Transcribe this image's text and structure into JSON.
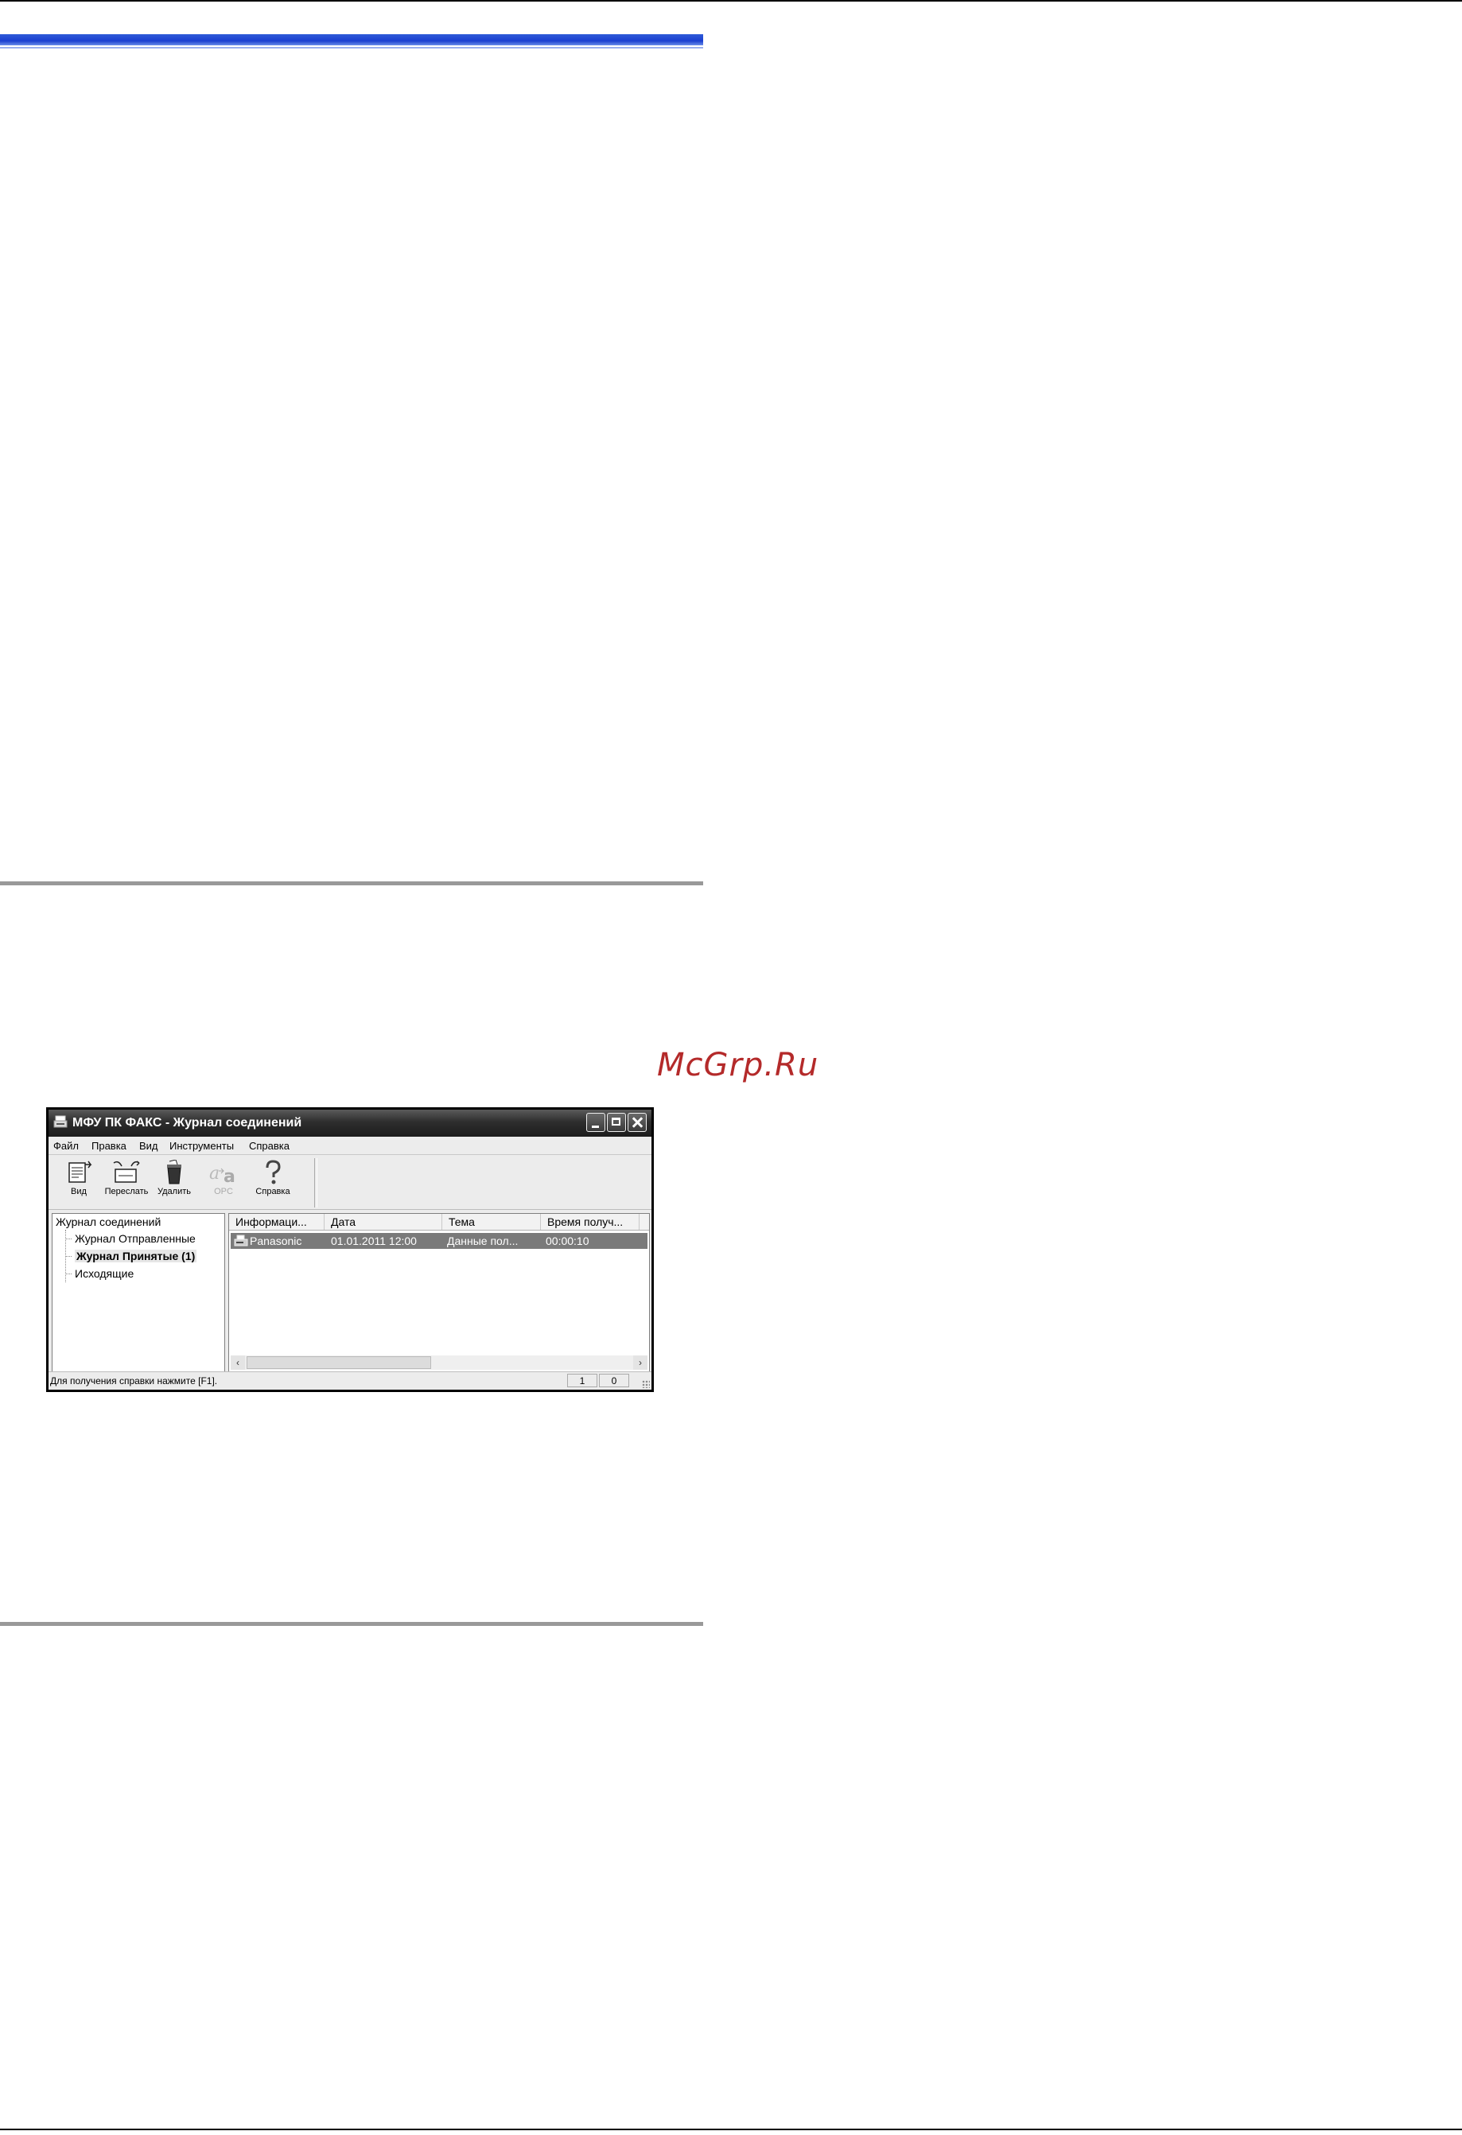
{
  "watermark": "McGrp.Ru",
  "window": {
    "title": "МФУ ПК ФАКС - Журнал соединений",
    "menu": [
      {
        "label": "Файл"
      },
      {
        "label": "Правка"
      },
      {
        "label": "Вид"
      },
      {
        "label": "Инструменты"
      },
      {
        "label": "Справка"
      }
    ],
    "toolbar": [
      {
        "label": "Вид",
        "icon": "view-icon",
        "enabled": true
      },
      {
        "label": "Переслать",
        "icon": "forward-icon",
        "enabled": true
      },
      {
        "label": "Удалить",
        "icon": "trash-icon",
        "enabled": true
      },
      {
        "label": "OPC",
        "icon": "ocr-icon",
        "enabled": false
      },
      {
        "label": "Справка",
        "icon": "help-icon",
        "enabled": true
      }
    ],
    "tree": {
      "root": "Журнал соединений",
      "children": [
        "Журнал Отправленные",
        "Журнал Принятые (1)",
        "Исходящие"
      ],
      "selected": "Журнал Принятые (1)"
    },
    "list": {
      "columns": [
        "Информаци...",
        "Дата",
        "Тема",
        "Время получ..."
      ],
      "rows": [
        {
          "info": "Panasonic",
          "date": "01.01.2011 12:00",
          "subject": "Данные пол...",
          "time": "00:00:10"
        }
      ]
    },
    "status": {
      "text": "Для получения справки нажмите [F1].",
      "pane1": "1",
      "pane2": "0"
    }
  }
}
